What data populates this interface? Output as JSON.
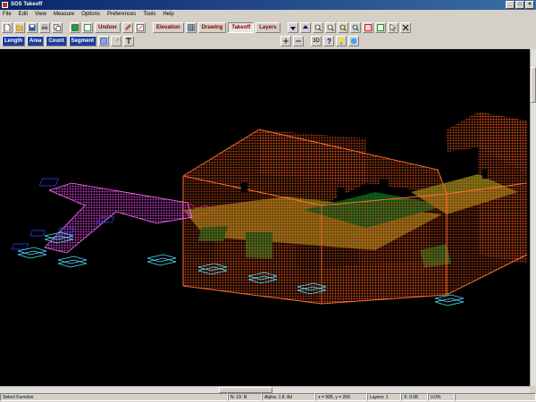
{
  "window": {
    "title": "SOS Takeoff"
  },
  "menu": [
    "File",
    "Edit",
    "View",
    "Measure",
    "Options",
    "Preferences",
    "Tools",
    "Help"
  ],
  "toolbar1": {
    "undoer": "Undoer",
    "elevation": "Elevation",
    "drawing": "Drawing",
    "takeoff": "Takeoff",
    "layers": "Layers"
  },
  "toolbar2": {
    "length": "Length",
    "area": "Area",
    "count": "Count",
    "segment": "Segment",
    "mode_3d": "3D"
  },
  "status": {
    "left": "Select Function",
    "cell2": "N: 19 .N",
    "cell3": "Alpha: 1.8 .8d",
    "cell4": "x = 995, y = 269",
    "cell5": "Layers: 1",
    "cell6": "X: 0.08",
    "cell7": "0.0%"
  }
}
